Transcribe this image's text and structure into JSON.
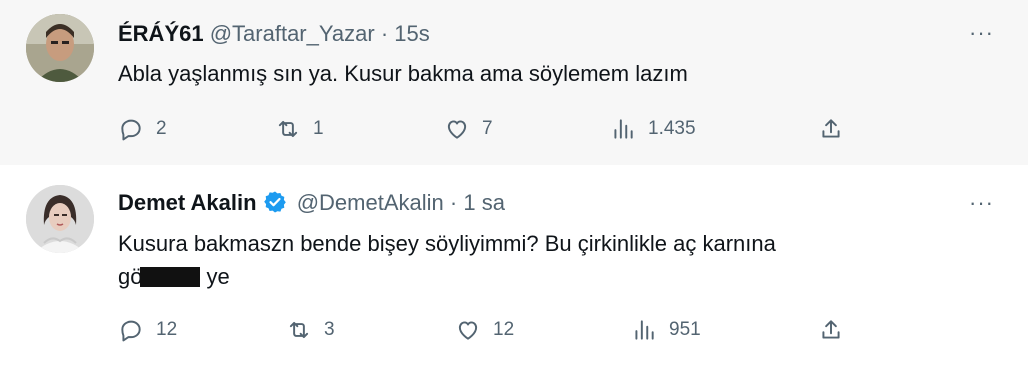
{
  "tweets": [
    {
      "name": "ÉRÁÝ61",
      "handle": "@Taraftar_Yazar",
      "sep": "·",
      "time": "15s",
      "text": "Abla yaşlanmış sın ya. Kusur bakma ama söylemem lazım",
      "replies": "2",
      "retweets": "1",
      "likes": "7",
      "views": "1.435",
      "more": "···"
    },
    {
      "name": "Demet Akalin",
      "handle": "@DemetAkalin",
      "sep": "·",
      "time": "1 sa",
      "text_line1": "Kusura bakmaszn bende bişey söyliyimmi? Bu çirkinlikle aç karnına",
      "text_line2_start": "gö",
      "text_line2_end": "ye",
      "replies": "12",
      "retweets": "3",
      "likes": "12",
      "views": "951",
      "more": "···",
      "verified_color": "#1d9bf0"
    }
  ],
  "colors": {
    "muted": "#536471",
    "thread_line": "#cfd9de",
    "highlight_bg": "#f7f7f7"
  }
}
